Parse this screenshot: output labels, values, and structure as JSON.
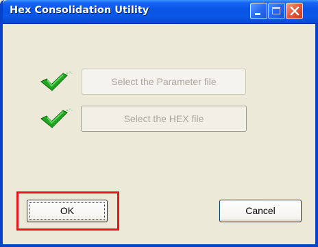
{
  "window": {
    "title": "Hex Consolidation Utility",
    "titlebar_color": "#0a58e8"
  },
  "rows": [
    {
      "icon": "checkmark-icon",
      "button_label": "Select the Parameter file",
      "enabled": false
    },
    {
      "icon": "checkmark-icon",
      "button_label": "Select the HEX file",
      "enabled": false
    }
  ],
  "footer": {
    "ok_label": "OK",
    "cancel_label": "Cancel",
    "highlight_color": "#e8141c"
  }
}
